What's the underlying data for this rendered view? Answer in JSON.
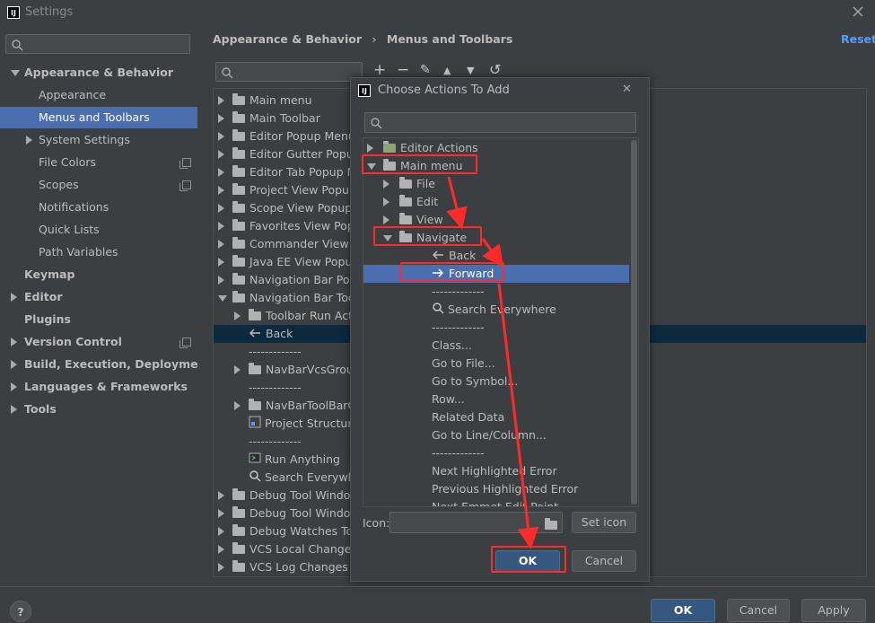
{
  "window": {
    "title": "Settings"
  },
  "sidebar": {
    "search_placeholder": "",
    "items": [
      {
        "label": "Appearance & Behavior",
        "bold": true,
        "expanded": true
      },
      {
        "label": "Appearance"
      },
      {
        "label": "Menus and Toolbars",
        "selected": true
      },
      {
        "label": "System Settings",
        "collapsed": true
      },
      {
        "label": "File Colors",
        "copy_icon": true
      },
      {
        "label": "Scopes",
        "copy_icon": true
      },
      {
        "label": "Notifications"
      },
      {
        "label": "Quick Lists"
      },
      {
        "label": "Path Variables"
      },
      {
        "label": "Keymap",
        "bold": true
      },
      {
        "label": "Editor",
        "bold": true,
        "collapsed": true
      },
      {
        "label": "Plugins",
        "bold": true
      },
      {
        "label": "Version Control",
        "bold": true,
        "collapsed": true,
        "copy_icon": true
      },
      {
        "label": "Build, Execution, Deployment",
        "bold": true,
        "collapsed": true
      },
      {
        "label": "Languages & Frameworks",
        "bold": true,
        "collapsed": true
      },
      {
        "label": "Tools",
        "bold": true,
        "collapsed": true
      }
    ]
  },
  "header": {
    "breadcrumb_parent": "Appearance & Behavior",
    "breadcrumb_sep": "›",
    "breadcrumb_current": "Menus and Toolbars",
    "reset_label": "Reset"
  },
  "toolbar": {
    "add": "+",
    "remove": "−",
    "edit": "✎",
    "up": "▲",
    "down": "▼",
    "restore": "↺"
  },
  "tree": [
    {
      "label": "Main menu",
      "kind": "folder",
      "arrow": "right",
      "indent": 0
    },
    {
      "label": "Main Toolbar",
      "kind": "folder",
      "arrow": "right",
      "indent": 0
    },
    {
      "label": "Editor Popup Menu",
      "kind": "folder",
      "arrow": "right",
      "indent": 0
    },
    {
      "label": "Editor Gutter Popup",
      "kind": "folder",
      "arrow": "right",
      "indent": 0
    },
    {
      "label": "Editor Tab Popup M",
      "kind": "folder",
      "arrow": "right",
      "indent": 0
    },
    {
      "label": "Project View Popup",
      "kind": "folder",
      "arrow": "right",
      "indent": 0
    },
    {
      "label": "Scope View Popup",
      "kind": "folder",
      "arrow": "right",
      "indent": 0
    },
    {
      "label": "Favorites View Popu",
      "kind": "folder",
      "arrow": "right",
      "indent": 0
    },
    {
      "label": "Commander View P",
      "kind": "folder",
      "arrow": "right",
      "indent": 0
    },
    {
      "label": "Java EE View Popup",
      "kind": "folder",
      "arrow": "right",
      "indent": 0
    },
    {
      "label": "Navigation Bar Pop",
      "kind": "folder",
      "arrow": "right",
      "indent": 0
    },
    {
      "label": "Navigation Bar Too",
      "kind": "folder",
      "arrow": "down",
      "indent": 0
    },
    {
      "label": "Toolbar Run Acti",
      "kind": "folder",
      "arrow": "right",
      "indent": 1
    },
    {
      "label": "Back",
      "kind": "back",
      "arrow": "none",
      "indent": 1,
      "selected": true
    },
    {
      "label": "-------------",
      "kind": "sep",
      "arrow": "none",
      "indent": 1
    },
    {
      "label": "NavBarVcsGroup",
      "kind": "folder",
      "arrow": "right",
      "indent": 1
    },
    {
      "label": "-------------",
      "kind": "sep",
      "arrow": "none",
      "indent": 1
    },
    {
      "label": "NavBarToolBarC",
      "kind": "folder",
      "arrow": "right",
      "indent": 1
    },
    {
      "label": "Project Structure",
      "kind": "struct",
      "arrow": "none",
      "indent": 1
    },
    {
      "label": "-------------",
      "kind": "sep",
      "arrow": "none",
      "indent": 1
    },
    {
      "label": "Run Anything",
      "kind": "run",
      "arrow": "none",
      "indent": 1
    },
    {
      "label": "Search Everywhe",
      "kind": "search",
      "arrow": "none",
      "indent": 1
    },
    {
      "label": "Debug Tool Windov",
      "kind": "folder",
      "arrow": "right",
      "indent": 0
    },
    {
      "label": "Debug Tool Windov",
      "kind": "folder",
      "arrow": "right",
      "indent": 0
    },
    {
      "label": "Debug Watches Too",
      "kind": "folder",
      "arrow": "right",
      "indent": 0
    },
    {
      "label": "VCS Local Changes",
      "kind": "folder",
      "arrow": "right",
      "indent": 0
    },
    {
      "label": "VCS Log Changes B",
      "kind": "folder",
      "arrow": "right",
      "indent": 0
    }
  ],
  "bottom": {
    "help": "?",
    "ok": "OK",
    "cancel": "Cancel",
    "apply": "Apply"
  },
  "dialog": {
    "title": "Choose Actions To Add",
    "close": "✕",
    "search_placeholder": "",
    "rows": [
      {
        "label": "Editor Actions",
        "kind": "editor",
        "arrow": "right",
        "indent": 0
      },
      {
        "label": "Main menu",
        "kind": "mainmenu",
        "arrow": "down",
        "indent": 0
      },
      {
        "label": "File",
        "kind": "folder",
        "arrow": "right",
        "indent": 1
      },
      {
        "label": "Edit",
        "kind": "folder",
        "arrow": "right",
        "indent": 1
      },
      {
        "label": "View",
        "kind": "folder",
        "arrow": "right",
        "indent": 1
      },
      {
        "label": "Navigate",
        "kind": "folder",
        "arrow": "down",
        "indent": 1
      },
      {
        "label": "Back",
        "kind": "back",
        "arrow": "none",
        "indent": 2
      },
      {
        "label": "Forward",
        "kind": "forward",
        "arrow": "none",
        "indent": 2,
        "selected": true
      },
      {
        "label": "-------------",
        "kind": "sep",
        "arrow": "none",
        "indent": 2
      },
      {
        "label": "Search Everywhere",
        "kind": "search",
        "arrow": "none",
        "indent": 2
      },
      {
        "label": "-------------",
        "kind": "sep",
        "arrow": "none",
        "indent": 2
      },
      {
        "label": "Class...",
        "kind": "text",
        "arrow": "none",
        "indent": 2
      },
      {
        "label": "Go to File...",
        "kind": "text",
        "arrow": "none",
        "indent": 2
      },
      {
        "label": "Go to Symbol...",
        "kind": "text",
        "arrow": "none",
        "indent": 2
      },
      {
        "label": "Row...",
        "kind": "text",
        "arrow": "none",
        "indent": 2
      },
      {
        "label": "Related Data",
        "kind": "text",
        "arrow": "none",
        "indent": 2
      },
      {
        "label": "Go to Line/Column...",
        "kind": "text",
        "arrow": "none",
        "indent": 2
      },
      {
        "label": "-------------",
        "kind": "sep",
        "arrow": "none",
        "indent": 2
      },
      {
        "label": "Next Highlighted Error",
        "kind": "text",
        "arrow": "none",
        "indent": 2
      },
      {
        "label": "Previous Highlighted Error",
        "kind": "text",
        "arrow": "none",
        "indent": 2
      },
      {
        "label": "Next Emmet Edit Point",
        "kind": "text",
        "arrow": "none",
        "indent": 2
      }
    ],
    "icon_label": "Icon:",
    "icon_value": "",
    "set_icon": "Set icon",
    "ok": "OK",
    "cancel": "Cancel"
  },
  "colors": {
    "background": "#3c3f41",
    "selection": "#4b6eaf",
    "primary_button": "#365880",
    "link": "#589df6",
    "annotation_red": "#ff2a2a"
  }
}
